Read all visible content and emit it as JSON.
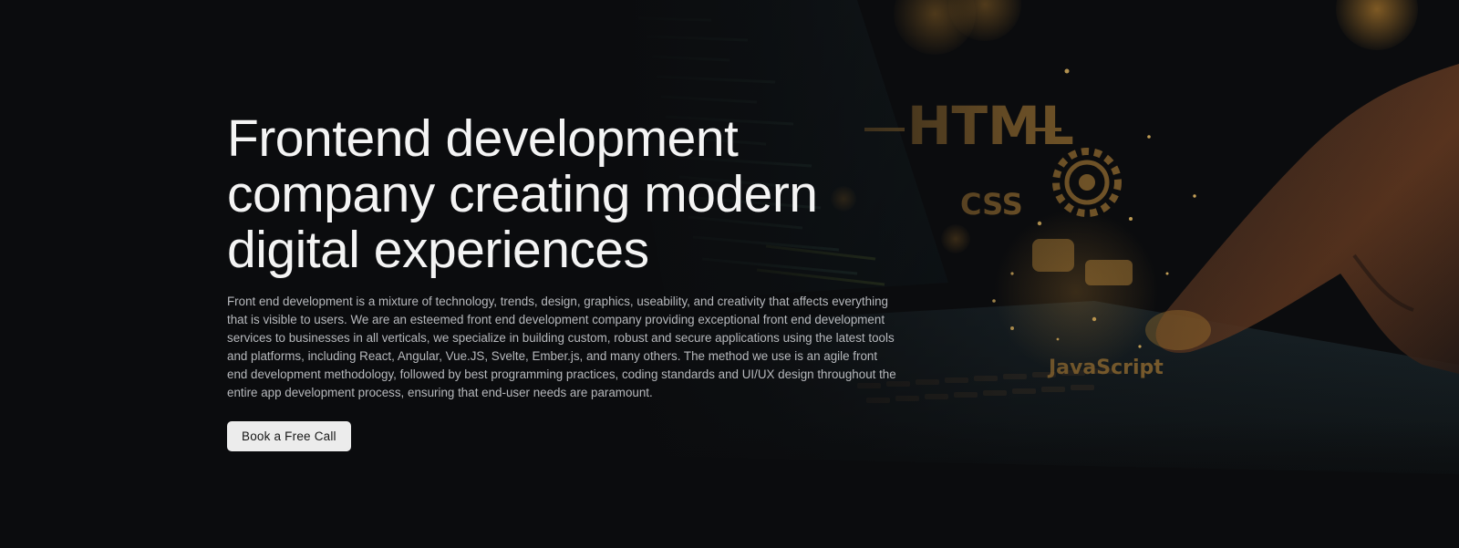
{
  "hero": {
    "title": "Frontend development company creating modern digital experiences",
    "description": "Front end development is a mixture of technology, trends, design, graphics, useability, and creativity that affects everything that is visible to users. We are an esteemed front end development company providing exceptional front end development services to businesses in all verticals, we specialize in building custom, robust and secure applications using the latest tools and platforms, including React, Angular, Vue.JS, Svelte, Ember.js, and many others. The method we use is an agile front end development methodology, followed by best programming practices, coding standards and UI/UX design throughout the entire app development process, ensuring that end-user needs are paramount.",
    "cta_label": "Book a Free Call"
  },
  "background_art": {
    "glyphs": [
      "HTML",
      "CSS",
      "JavaScript"
    ],
    "icons": [
      "gear-icon"
    ]
  },
  "colors": {
    "background": "#0b0c0e",
    "title": "#f4f4f4",
    "body_text": "#b7b9bd",
    "cta_background": "#ececec",
    "glow": "#f0a63a"
  }
}
